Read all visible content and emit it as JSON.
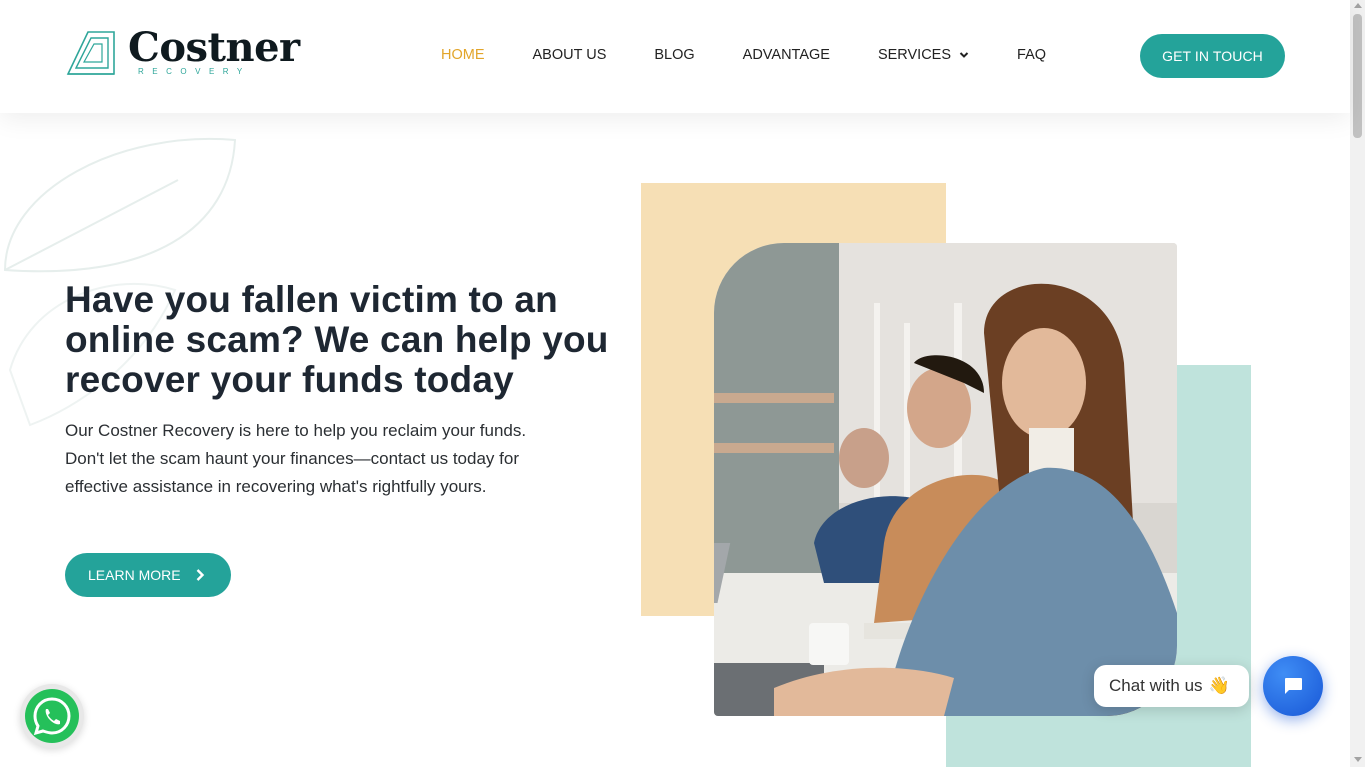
{
  "brand": {
    "name": "Costner",
    "tagline": "RECOVERY",
    "accent": "#24a39a",
    "highlight": "#e2a52a"
  },
  "nav": {
    "items": [
      {
        "label": "HOME",
        "active": true
      },
      {
        "label": "ABOUT US",
        "active": false
      },
      {
        "label": "BLOG",
        "active": false
      },
      {
        "label": "ADVANTAGE",
        "active": false
      },
      {
        "label": "SERVICES",
        "active": false,
        "dropdown": true
      },
      {
        "label": "FAQ",
        "active": false
      }
    ],
    "cta_label": "GET IN TOUCH"
  },
  "hero": {
    "title": "Have you fallen victim to an online scam? We can help you recover your funds today",
    "text": "Our Costner Recovery is here to help you reclaim your funds. Don't let the scam haunt your finances—contact us today for effective assistance in recovering what's rightfully yours.",
    "button_label": "LEARN MORE",
    "colors": {
      "yellow_block": "#f6dfb5",
      "teal_block": "#bfe3dc"
    }
  },
  "widgets": {
    "chat_label": "Chat with us",
    "chat_emoji": "👋",
    "whatsapp_icon": "whatsapp-icon",
    "chat_icon": "chat-icon"
  }
}
